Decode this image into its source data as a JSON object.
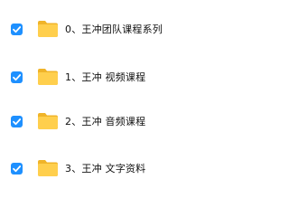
{
  "colors": {
    "checkbox_fill": "#1e90ff",
    "checkmark": "#ffffff",
    "folder_back": "#f0b429",
    "folder_front": "#ffcf4d",
    "text": "#111111"
  },
  "files": [
    {
      "name": "0、王冲团队课程系列",
      "checked": true,
      "icon": "folder-icon"
    },
    {
      "name": "1、王冲 视频课程",
      "checked": true,
      "icon": "folder-icon"
    },
    {
      "name": "2、王冲 音频课程",
      "checked": true,
      "icon": "folder-icon"
    },
    {
      "name": "3、王冲 文字资料",
      "checked": true,
      "icon": "folder-icon"
    }
  ]
}
